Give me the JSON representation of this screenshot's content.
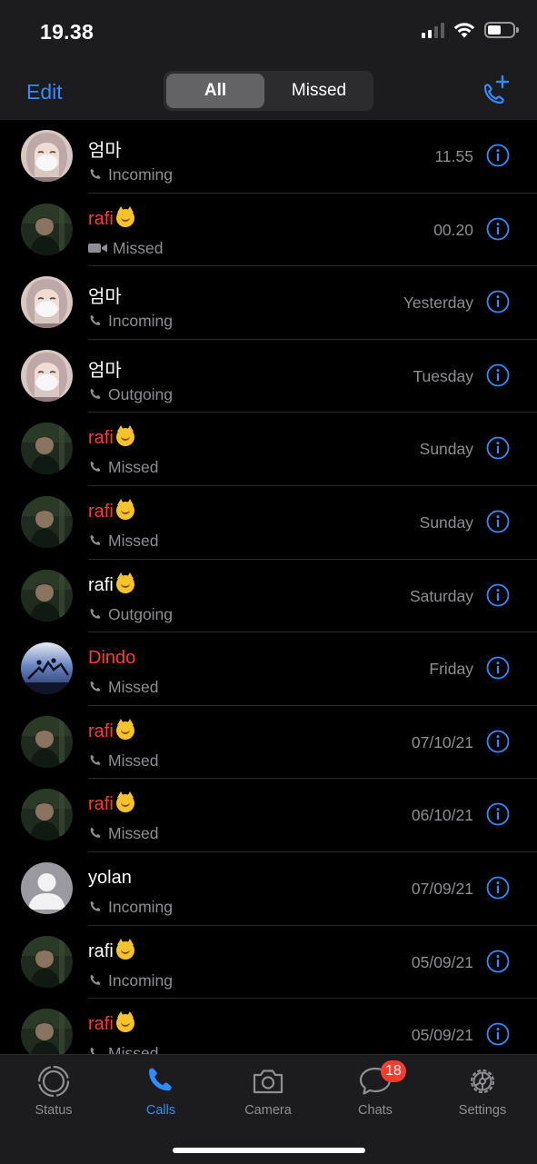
{
  "status_bar": {
    "time": "19.38"
  },
  "header": {
    "edit_label": "Edit",
    "segments": [
      {
        "label": "All",
        "selected": true
      },
      {
        "label": "Missed",
        "selected": false
      }
    ],
    "new_call_icon": "phone-plus-icon"
  },
  "calls": [
    {
      "name": "엄마",
      "emoji": false,
      "missed": false,
      "type": "Incoming",
      "call_icon": "phone-icon",
      "date": "11.55",
      "avatar": "mom"
    },
    {
      "name": "rafi",
      "emoji": true,
      "missed": true,
      "type": "Missed",
      "call_icon": "video-icon",
      "date": "00.20",
      "avatar": "rafi"
    },
    {
      "name": "엄마",
      "emoji": false,
      "missed": false,
      "type": "Incoming",
      "call_icon": "phone-icon",
      "date": "Yesterday",
      "avatar": "mom"
    },
    {
      "name": "엄마",
      "emoji": false,
      "missed": false,
      "type": "Outgoing",
      "call_icon": "phone-icon",
      "date": "Tuesday",
      "avatar": "mom"
    },
    {
      "name": "rafi",
      "emoji": true,
      "missed": true,
      "type": "Missed",
      "call_icon": "phone-icon",
      "date": "Sunday",
      "avatar": "rafi"
    },
    {
      "name": "rafi",
      "emoji": true,
      "missed": true,
      "type": "Missed",
      "call_icon": "phone-icon",
      "date": "Sunday",
      "avatar": "rafi"
    },
    {
      "name": "rafi",
      "emoji": true,
      "missed": false,
      "type": "Outgoing",
      "call_icon": "phone-icon",
      "date": "Saturday",
      "avatar": "rafi"
    },
    {
      "name": "Dindo",
      "emoji": false,
      "missed": true,
      "type": "Missed",
      "call_icon": "phone-icon",
      "date": "Friday",
      "avatar": "dindo"
    },
    {
      "name": "rafi",
      "emoji": true,
      "missed": true,
      "type": "Missed",
      "call_icon": "phone-icon",
      "date": "07/10/21",
      "avatar": "rafi"
    },
    {
      "name": "rafi",
      "emoji": true,
      "missed": true,
      "type": "Missed",
      "call_icon": "phone-icon",
      "date": "06/10/21",
      "avatar": "rafi"
    },
    {
      "name": "yolan",
      "emoji": false,
      "missed": false,
      "type": "Incoming",
      "call_icon": "phone-icon",
      "date": "07/09/21",
      "avatar": "default"
    },
    {
      "name": "rafi",
      "emoji": true,
      "missed": false,
      "type": "Incoming",
      "call_icon": "phone-icon",
      "date": "05/09/21",
      "avatar": "rafi"
    },
    {
      "name": "rafi",
      "emoji": true,
      "missed": true,
      "type": "Missed",
      "call_icon": "phone-icon",
      "date": "05/09/21",
      "avatar": "rafi"
    }
  ],
  "tabs": [
    {
      "label": "Status",
      "icon": "status-icon",
      "active": false
    },
    {
      "label": "Calls",
      "icon": "phone-icon",
      "active": true
    },
    {
      "label": "Camera",
      "icon": "camera-icon",
      "active": false
    },
    {
      "label": "Chats",
      "icon": "chat-icon",
      "active": false,
      "badge": "18"
    },
    {
      "label": "Settings",
      "icon": "gear-icon",
      "active": false
    }
  ],
  "colors": {
    "accent": "#2f8cff",
    "missed": "#ff3b30",
    "secondary_text": "#8e8e93",
    "bar_bg": "#1c1c1e"
  }
}
